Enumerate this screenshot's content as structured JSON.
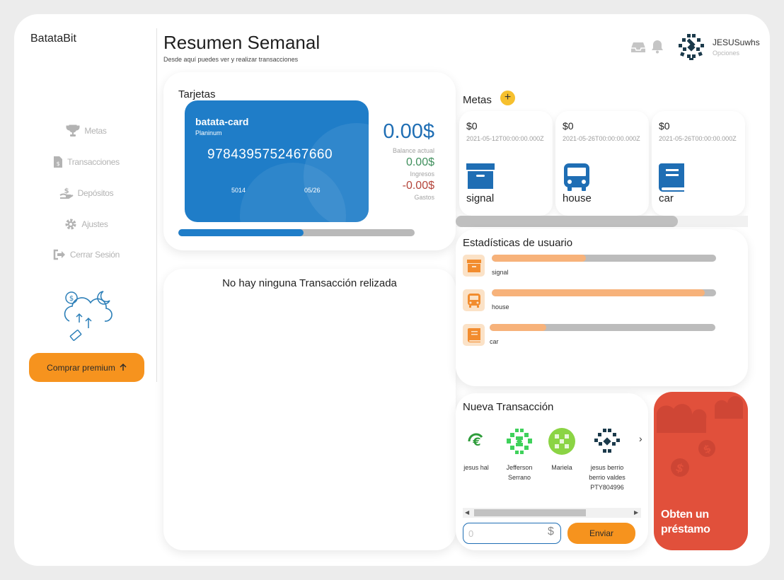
{
  "app": {
    "brand": "BatataBit"
  },
  "sidebar": {
    "items": [
      {
        "label": "Metas",
        "icon": "trophy-icon"
      },
      {
        "label": "Transacciones",
        "icon": "invoice-icon"
      },
      {
        "label": "Depósitos",
        "icon": "hand-coin-icon"
      },
      {
        "label": "Ajustes",
        "icon": "gear-icon"
      },
      {
        "label": "Cerrar Sesión",
        "icon": "logout-icon"
      }
    ],
    "illustration": "cloud-upload-illustration",
    "premium_button": "Comprar premium"
  },
  "header": {
    "title": "Resumen Semanal",
    "subtitle": "Desde aquí puedes ver y realizar transacciones",
    "user": {
      "name": "JESUSuwhs",
      "menu": "Opciones"
    }
  },
  "cards": {
    "title": "Tarjetas",
    "card": {
      "name": "batata-card",
      "type": "Planinum",
      "number": "9784395752467660",
      "cvv": "5014",
      "expiry": "05/26",
      "color": "#1f7dc8"
    },
    "balance": {
      "amount": "0.00$",
      "label": "Balance actual"
    },
    "income": {
      "amount": "0.00$",
      "label": "Ingresos"
    },
    "expenses": {
      "amount": "-0.00$",
      "label": "Gastos"
    },
    "progress_fraction": 0.53
  },
  "transactions": {
    "empty_message": "No hay ninguna Transacción relizada"
  },
  "goals": {
    "title": "Metas",
    "add_label": "+",
    "items": [
      {
        "amount": "$0",
        "date": "2021-05-12T00:00:00.000Z",
        "name": "signal",
        "icon": "archive-box-icon"
      },
      {
        "amount": "$0",
        "date": "2021-05-26T00:00:00.000Z",
        "name": "house",
        "icon": "bus-icon"
      },
      {
        "amount": "$0",
        "date": "2021-05-26T00:00:00.000Z",
        "name": "car",
        "icon": "book-icon"
      }
    ]
  },
  "stats": {
    "title": "Estadísticas de usuario",
    "items": [
      {
        "label": "signal",
        "fraction": 0.42,
        "icon": "archive-box-icon"
      },
      {
        "label": "house",
        "fraction": 0.95,
        "icon": "bus-icon"
      },
      {
        "label": "car",
        "fraction": 0.25,
        "icon": "book-icon"
      }
    ]
  },
  "new_transaction": {
    "title": "Nueva Transacción",
    "contacts": [
      {
        "name": "jesus hal",
        "avatar": "euro-coin-avatar"
      },
      {
        "name": "Jefferson Serrano",
        "avatar": "green-pattern-avatar"
      },
      {
        "name": "Mariela",
        "avatar": "lime-pattern-avatar"
      },
      {
        "name": "jesus berrio berrio valdes PTY804996",
        "avatar": "navy-pattern-avatar"
      }
    ],
    "amount_placeholder": "0",
    "currency": "$",
    "send_button": "Enviar"
  },
  "loan": {
    "text": "Obten un préstamo"
  },
  "colors": {
    "accent_orange": "#f6931e",
    "card_blue": "#1f7dc8",
    "income_green": "#3f8f5c",
    "expense_red": "#b4443a",
    "loan_red": "#e1503b",
    "stat_fill": "#f7b27a"
  }
}
